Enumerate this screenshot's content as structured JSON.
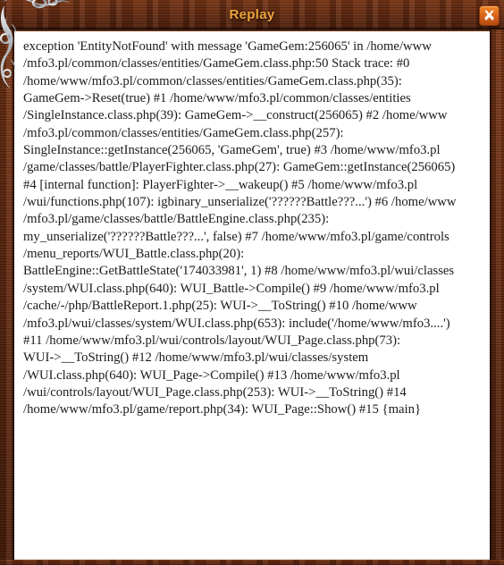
{
  "window": {
    "title": "Replay",
    "close_label": "×",
    "title_color": "#f0a63c",
    "frame_color": "#6e2f12",
    "close_button_color": "#d9621a",
    "content_background": "#ffffff",
    "text_color": "#1c1c1c"
  },
  "icons": {
    "close": "close-icon",
    "ornament": "corner-ornament-icon"
  },
  "report": {
    "lines": [
      "exception 'EntityNotFound' with message 'GameGem:256065' in /home/www",
      "/mfo3.pl/common/classes/entities/GameGem.class.php:50 Stack trace: #0",
      "/home/www/mfo3.pl/common/classes/entities/GameGem.class.php(35):",
      "GameGem->Reset(true) #1 /home/www/mfo3.pl/common/classes/entities",
      "/SingleInstance.class.php(39): GameGem->__construct(256065) #2 /home/www",
      "/mfo3.pl/common/classes/entities/GameGem.class.php(257):",
      "SingleInstance::getInstance(256065, 'GameGem', true) #3 /home/www/mfo3.pl",
      "/game/classes/battle/PlayerFighter.class.php(27): GameGem::getInstance(256065)",
      "#4 [internal function]: PlayerFighter->__wakeup() #5 /home/www/mfo3.pl",
      "/wui/functions.php(107): igbinary_unserialize('??????Battle???...') #6 /home/www",
      "/mfo3.pl/game/classes/battle/BattleEngine.class.php(235):",
      "my_unserialize('??????Battle???...', false) #7 /home/www/mfo3.pl/game/controls",
      "/menu_reports/WUI_Battle.class.php(20):",
      "BattleEngine::GetBattleState('174033981', 1) #8 /home/www/mfo3.pl/wui/classes",
      "/system/WUI.class.php(640): WUI_Battle->Compile() #9 /home/www/mfo3.pl",
      "/cache/-/php/BattleReport.1.php(25): WUI->__ToString() #10 /home/www",
      "/mfo3.pl/wui/classes/system/WUI.class.php(653): include('/home/www/mfo3....')",
      "#11 /home/www/mfo3.pl/wui/controls/layout/WUI_Page.class.php(73):",
      "WUI->__ToString() #12 /home/www/mfo3.pl/wui/classes/system",
      "/WUI.class.php(640): WUI_Page->Compile() #13 /home/www/mfo3.pl",
      "/wui/controls/layout/WUI_Page.class.php(253): WUI->__ToString() #14",
      "/home/www/mfo3.pl/game/report.php(34): WUI_Page::Show() #15 {main}"
    ]
  }
}
